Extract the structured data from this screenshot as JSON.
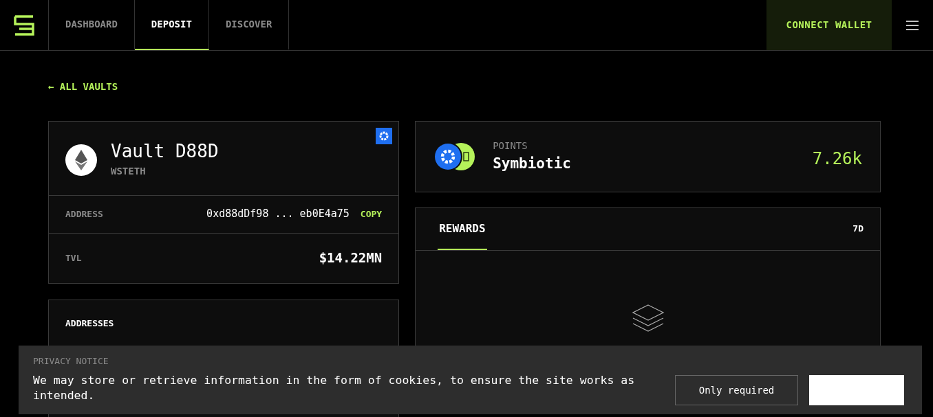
{
  "nav": {
    "tabs": [
      {
        "label": "DASHBOARD",
        "selected": false
      },
      {
        "label": "DEPOSIT",
        "selected": true
      },
      {
        "label": "DISCOVER",
        "selected": false
      }
    ],
    "connect_button": "CONNECT WALLET"
  },
  "back_link": "← ALL VAULTS",
  "vault": {
    "title": "Vault D88D",
    "token": "WSTETH",
    "rows": [
      {
        "label": "ADDRESS",
        "value_start": "0xd88dDf98",
        "ellipsis": "...",
        "value_end": "eb0E4a75",
        "action": "COPY"
      },
      {
        "label": "TVL",
        "value": "$14.22MN"
      }
    ]
  },
  "addresses_card": {
    "title": "ADDRESSES"
  },
  "points": {
    "label": "POINTS",
    "name": "Symbiotic",
    "value": "7.26k"
  },
  "rewards": {
    "tabs": [
      {
        "label": "REWARDS",
        "selected": true
      }
    ],
    "period": "7D"
  },
  "privacy_notice": {
    "title": "PRIVACY NOTICE",
    "text": "We may store or retrieve information in the form of cookies, to ensure the site works as intended.",
    "buttons": [
      {
        "label": "Only required",
        "kind": "outline"
      },
      {
        "kind": "solid"
      }
    ]
  }
}
